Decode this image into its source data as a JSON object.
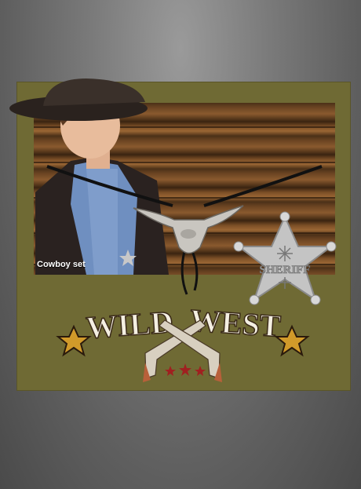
{
  "product": {
    "caption": "Cowboy set",
    "badge_text": "SHERIFF",
    "title_word1": "WILD",
    "title_word2": "WEST"
  },
  "colors": {
    "card": "#6f6a34",
    "star_fill": "#d19a2a",
    "title_fill": "#f4efe2",
    "accent_red": "#a02020"
  }
}
